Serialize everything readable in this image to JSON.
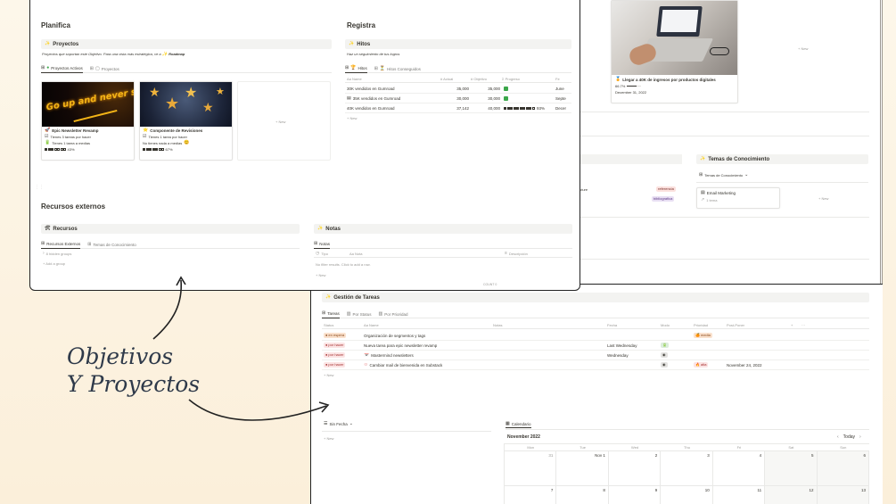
{
  "top_window": {
    "planifica": {
      "heading": "Planifica",
      "proyectos": {
        "title": "Proyectos",
        "subtitle": "Proyectos que soportan este Objetivo. Para una vista más estratégica, ve a",
        "roadmap": "Roadmap",
        "tabs": [
          "Proyectos Activos",
          "Proyectos"
        ],
        "cards": [
          {
            "title": "Epic Newsletter Revamp",
            "l1": "Tienes 3 tareas por hacer",
            "l2": "Tienes 1 tarea a medias",
            "pct": "43%",
            "image_text": "Go up and never stop"
          },
          {
            "title": "Componente de Revisiones",
            "l1": "Tienes 1 tarea por hacer",
            "l2": "No tienes nada a medias",
            "pct": "67%"
          }
        ],
        "new": "+ New"
      }
    },
    "registra": {
      "heading": "Registra",
      "hitos": {
        "title": "Hitos",
        "subtitle": "Haz un seguimiento de tus logros",
        "tabs": [
          "Hitos",
          "Hitos Conseguidos"
        ],
        "columns": [
          "Aa Name",
          "# Actual",
          "# Objetivo",
          "Σ Progreso",
          "Fe"
        ],
        "rows": [
          {
            "name": "30K vendidos en Gumroad",
            "actual": "35,000",
            "objetivo": "35,000",
            "fecha": "June"
          },
          {
            "name": "35K vendidos en Gumroad",
            "actual": "30,000",
            "objetivo": "30,000",
            "fecha": "Septe"
          },
          {
            "name": "40K vendidos en Gumroad",
            "actual": "37,142",
            "objetivo": "40,000",
            "progreso": "93%",
            "fecha": "Decer"
          }
        ],
        "new": "+ New"
      }
    },
    "recursos_externos": {
      "heading": "Recursos externos",
      "recursos": {
        "title": "Recursos",
        "tabs": [
          "Recursos Externos",
          "Temas de Conocimiento"
        ],
        "hidden_groups": "8 hidden groups",
        "add_group": "+ Add a group"
      },
      "notas": {
        "title": "Notas",
        "tabs": [
          "Notas"
        ],
        "columns": [
          "Tipo",
          "Aa Nota",
          "Descripción"
        ],
        "empty": "No filter results. Click to add a row.",
        "new": "+ New",
        "count": "COUNT 0"
      }
    }
  },
  "right_bg": {
    "goal_card": {
      "title": "Llegar a 40K de ingresos por productos digitales",
      "pct": "66.7%",
      "date": "December 31, 2022"
    },
    "new": "+ New",
    "temas": {
      "title": "Temas de Conocimiento",
      "view": "Temas de Conocimiento",
      "card_title": "Email Marketing",
      "card_sub": "1 tema",
      "new": "+ New"
    },
    "partial_text": "uture",
    "tags": [
      "referencia",
      "bibliografica"
    ]
  },
  "bottom_window": {
    "gestion": {
      "title": "Gestión de Tareas",
      "tabs": [
        "Tareas",
        "Por Status",
        "Por Prioridad"
      ],
      "columns": [
        "Status",
        "Aa Name",
        "Notas",
        "Fecha",
        "Modo",
        "Prioridad",
        "Post-Poner",
        "+",
        "···"
      ],
      "rows": [
        {
          "status": "en espera",
          "name": "Organización de segmentos y tags",
          "fecha": "",
          "prioridad": "media",
          "post": ""
        },
        {
          "status": "por hacer",
          "name": "Nueva tarea para epic newsletter revamp",
          "fecha": "Last Wednesday",
          "prioridad": "",
          "post": ""
        },
        {
          "status": "por hacer",
          "name": "Mastermind newsletters",
          "fecha": "Wednesday",
          "prioridad": "",
          "post": ""
        },
        {
          "status": "por hacer",
          "name": "Cambiar mail de bienvenida en Substack",
          "fecha": "",
          "prioridad": "alta",
          "post": "November 24, 2022"
        }
      ],
      "new": "+ New"
    },
    "sin_fecha": {
      "title": "Sin Fecha",
      "new": "+ New"
    },
    "calendario": {
      "tab": "Calendario",
      "month": "November 2022",
      "today": "Today",
      "days": [
        "Mon",
        "Tue",
        "Wed",
        "Thu",
        "Fri",
        "Sat",
        "Sun"
      ],
      "week1": [
        "31",
        "Nov 1",
        "2",
        "3",
        "4",
        "5",
        "6"
      ],
      "week2": [
        "7",
        "8",
        "9",
        "10",
        "11",
        "12",
        "13"
      ]
    }
  },
  "overlay": {
    "line1": "Objetivos",
    "line2": "Y Proyectos"
  }
}
